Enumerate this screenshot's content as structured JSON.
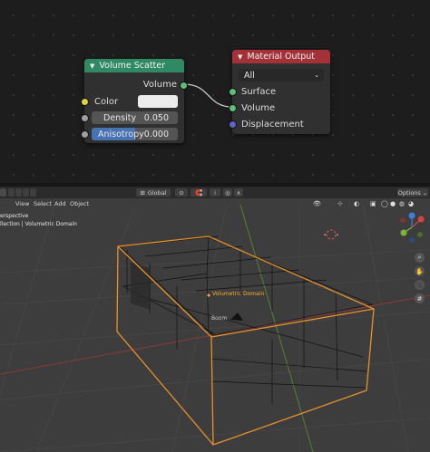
{
  "node_editor": {
    "volume_scatter": {
      "title": "Volume Scatter",
      "output_label": "Volume",
      "color_label": "Color",
      "density_label": "Density",
      "density_value": "0.050",
      "anisotropy_label": "Anisotropy",
      "anisotropy_value": "0.000",
      "anisotropy_fill": 0.5,
      "header_color": "#2f8a63"
    },
    "material_output": {
      "title": "Material Output",
      "target_value": "All",
      "surface_label": "Surface",
      "volume_label": "Volume",
      "displacement_label": "Displacement",
      "header_color": "#a33137"
    }
  },
  "viewport": {
    "header": {
      "transform_orientation": "Global",
      "options_label": "Options"
    },
    "menus": [
      "View",
      "Select",
      "Add",
      "Object"
    ],
    "info": {
      "view_name": "erspective",
      "collection_path": "llection | Volumetric Domain"
    },
    "labels": {
      "object_name": "Volumetric Domain",
      "light_name": "Boom"
    },
    "gizmo": {
      "x_color": "#d4433f",
      "y_color": "#7cb43c",
      "z_color": "#3a7fd8"
    }
  }
}
